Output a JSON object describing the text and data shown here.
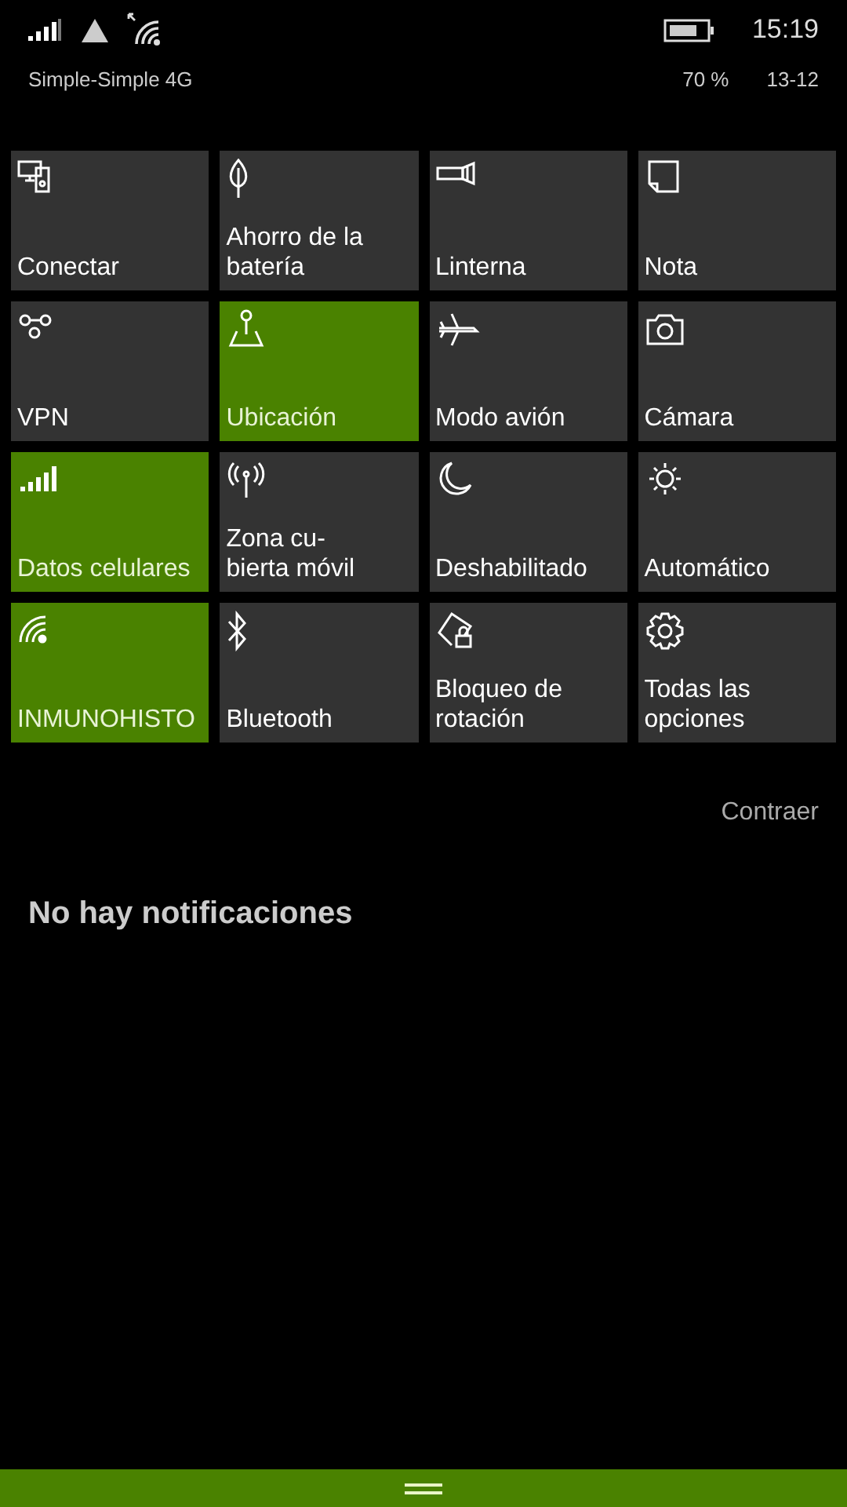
{
  "status_bar": {
    "time": "15:19",
    "carrier": "Simple-Simple 4G",
    "battery_percent": "70 %",
    "date": "13-12"
  },
  "quick_actions": [
    {
      "kind": "project",
      "lines": [
        "Conectar"
      ],
      "selected": false
    },
    {
      "kind": "leaf",
      "lines": [
        "Ahorro de la",
        "batería"
      ],
      "selected": false
    },
    {
      "kind": "flashlight",
      "lines": [
        "Linterna"
      ],
      "selected": false
    },
    {
      "kind": "note",
      "lines": [
        "Nota"
      ],
      "selected": false
    },
    {
      "kind": "vpn",
      "lines": [
        "VPN"
      ],
      "selected": false
    },
    {
      "kind": "location",
      "lines": [
        "Ubicación"
      ],
      "selected": true
    },
    {
      "kind": "airplane",
      "lines": [
        "Modo avión"
      ],
      "selected": false
    },
    {
      "kind": "camera",
      "lines": [
        "Cámara"
      ],
      "selected": false
    },
    {
      "kind": "cellular",
      "lines": [
        "Datos celulares"
      ],
      "selected": true
    },
    {
      "kind": "hotspot",
      "lines": [
        "Zona cu-",
        "bierta móvil"
      ],
      "selected": false
    },
    {
      "kind": "moon",
      "lines": [
        "Deshabilitado"
      ],
      "selected": false
    },
    {
      "kind": "brightness",
      "lines": [
        "Automático"
      ],
      "selected": false
    },
    {
      "kind": "wifi",
      "lines": [
        "INMUNOHISTO"
      ],
      "selected": true
    },
    {
      "kind": "bluetooth",
      "lines": [
        "Bluetooth"
      ],
      "selected": false
    },
    {
      "kind": "rotation",
      "lines": [
        "Bloqueo de",
        "rotación"
      ],
      "selected": false
    },
    {
      "kind": "settings",
      "lines": [
        "Todas las",
        "opciones"
      ],
      "selected": false
    }
  ],
  "collapse_link": "Contraer",
  "notifications": {
    "empty_message": "No hay notificaciones"
  }
}
